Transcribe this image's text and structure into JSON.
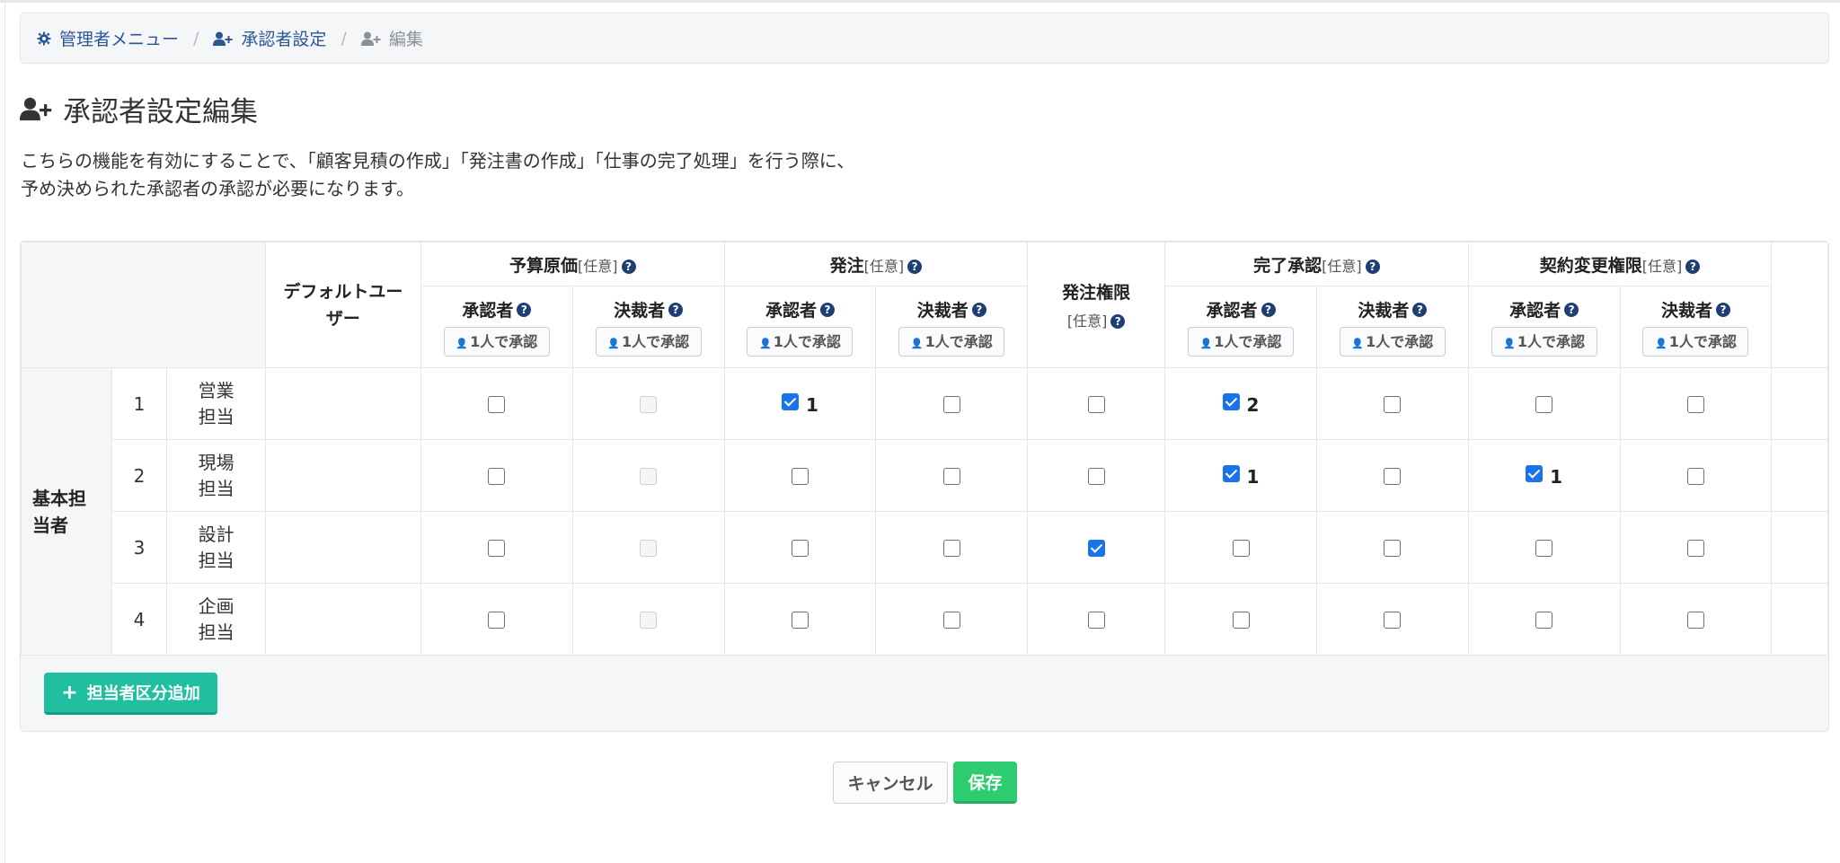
{
  "breadcrumb": {
    "admin_menu": "管理者メニュー",
    "approver_settings": "承認者設定",
    "edit": "編集",
    "separator": "/"
  },
  "page": {
    "title": "承認者設定編集",
    "description_line1": "こちらの機能を有効にすることで、「顧客見積の作成」「発注書の作成」「仕事の完了処理」を行う際に、",
    "description_line2": "予め決められた承認者の承認が必要になります。"
  },
  "table": {
    "default_user_label": "デフォルトユーザー",
    "optional": "[任意]",
    "help_mark": "?",
    "groups": [
      {
        "name": "予算原価"
      },
      {
        "name": "発注"
      },
      {
        "name": "完了承認"
      },
      {
        "name": "契約変更権限"
      }
    ],
    "order_authority": "発注権限",
    "approver_label": "承認者",
    "decider_label": "決裁者",
    "single_approve_label": "1人で承認",
    "row_group_label": "基本担当者",
    "rows": [
      {
        "num": "1",
        "role": "営業担当",
        "cells": [
          {
            "state": "unchecked"
          },
          {
            "state": "disabled"
          },
          {
            "state": "checked",
            "order": "1"
          },
          {
            "state": "unchecked"
          },
          {
            "state": "unchecked"
          },
          {
            "state": "checked",
            "order": "2"
          },
          {
            "state": "unchecked"
          },
          {
            "state": "unchecked"
          },
          {
            "state": "unchecked"
          }
        ]
      },
      {
        "num": "2",
        "role": "現場担当",
        "cells": [
          {
            "state": "unchecked"
          },
          {
            "state": "disabled"
          },
          {
            "state": "unchecked"
          },
          {
            "state": "unchecked"
          },
          {
            "state": "unchecked"
          },
          {
            "state": "checked",
            "order": "1"
          },
          {
            "state": "unchecked"
          },
          {
            "state": "checked",
            "order": "1"
          },
          {
            "state": "unchecked"
          }
        ]
      },
      {
        "num": "3",
        "role": "設計担当",
        "cells": [
          {
            "state": "unchecked"
          },
          {
            "state": "disabled"
          },
          {
            "state": "unchecked"
          },
          {
            "state": "unchecked"
          },
          {
            "state": "checked"
          },
          {
            "state": "unchecked"
          },
          {
            "state": "unchecked"
          },
          {
            "state": "unchecked"
          },
          {
            "state": "unchecked"
          }
        ]
      },
      {
        "num": "4",
        "role": "企画担当",
        "cells": [
          {
            "state": "unchecked"
          },
          {
            "state": "disabled"
          },
          {
            "state": "unchecked"
          },
          {
            "state": "unchecked"
          },
          {
            "state": "unchecked"
          },
          {
            "state": "unchecked"
          },
          {
            "state": "unchecked"
          },
          {
            "state": "unchecked"
          },
          {
            "state": "unchecked"
          }
        ]
      }
    ]
  },
  "buttons": {
    "add_category": "担当者区分追加",
    "cancel": "キャンセル",
    "save": "保存"
  },
  "colors": {
    "accent_teal": "#1fbf9f",
    "save_green": "#2ecc71",
    "link_blue": "#2b5797",
    "checkbox_blue": "#1a73e8"
  }
}
